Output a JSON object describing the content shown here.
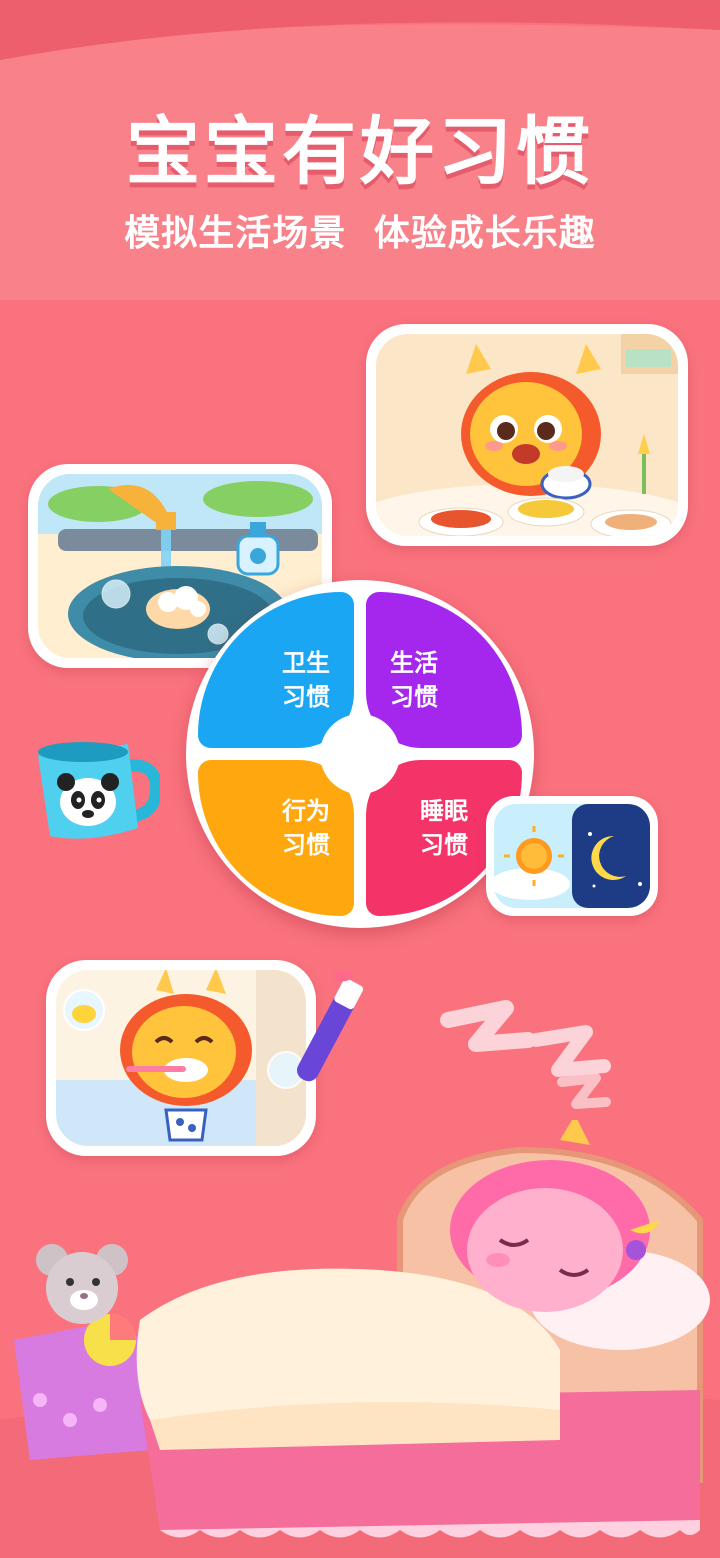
{
  "header": {
    "title": "宝宝有好习惯",
    "subtitle": "模拟生活场景  体验成长乐趣"
  },
  "wheel": {
    "items": [
      {
        "line1": "卫生",
        "line2": "习惯",
        "color": "#1aa6f2"
      },
      {
        "line1": "生活",
        "line2": "习惯",
        "color": "#a527ee"
      },
      {
        "line1": "行为",
        "line2": "习惯",
        "color": "#ffa70e"
      },
      {
        "line1": "睡眠",
        "line2": "习惯",
        "color": "#f43469"
      }
    ]
  },
  "colors": {
    "background": "#f9727d",
    "wave": "#fa8e94",
    "title_shadow": "#d64056"
  },
  "illustrations": [
    "dragon-eating-meal-scene",
    "hand-washing-sink-scene",
    "panda-cup-icon",
    "day-night-sun-moon-card",
    "dragon-brushing-teeth-scene",
    "sleeping-zzz-icon",
    "pink-dragon-sleeping-in-bed-scene",
    "teddy-bear-toy-box"
  ]
}
